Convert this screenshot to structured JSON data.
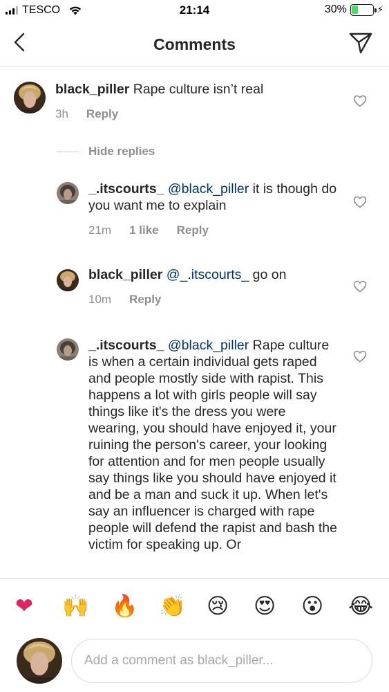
{
  "status_bar": {
    "carrier": "TESCO",
    "time": "21:14",
    "battery_percent": "30%",
    "battery_level": 0.3,
    "wifi_icon": "wifi-icon",
    "charging_icon": "charging-bolt-icon"
  },
  "header": {
    "title": "Comments",
    "back_icon": "chevron-left-icon",
    "send_icon": "paper-plane-icon"
  },
  "comments": [
    {
      "username": "black_piller",
      "mention": "",
      "text": "Rape culture isn’t real",
      "time": "3h",
      "likes": "",
      "reply_label": "Reply"
    }
  ],
  "hide_replies_label": "Hide replies",
  "replies": [
    {
      "username": "_.itscourts_",
      "mention": "@black_piller",
      "text": "it is though do you want me to explain",
      "time": "21m",
      "likes": "1 like",
      "reply_label": "Reply"
    },
    {
      "username": "black_piller",
      "mention": "@_.itscourts_",
      "text": "go on",
      "time": "10m",
      "likes": "",
      "reply_label": "Reply"
    },
    {
      "username": "_.itscourts_",
      "mention": "@black_piller",
      "text": "Rape culture is when a certain individual gets raped and people mostly side with rapist. This happens a lot with girls people will say things like it's the dress you were wearing, you should have enjoyed it, your ruining the person's career, your looking for attention and for men people usually say things like you should have enjoyed it and be a man and suck it up. When let's say an influencer is charged with rape people will defend the rapist and bash the victim for speaking up. Or",
      "time": "",
      "likes": "",
      "reply_label": ""
    }
  ],
  "emoji_bar": [
    "❤",
    "🙌",
    "🔥",
    "👏",
    "😢",
    "😍",
    "😮",
    "😂"
  ],
  "composer": {
    "placeholder": "Add a comment as black_piller..."
  }
}
